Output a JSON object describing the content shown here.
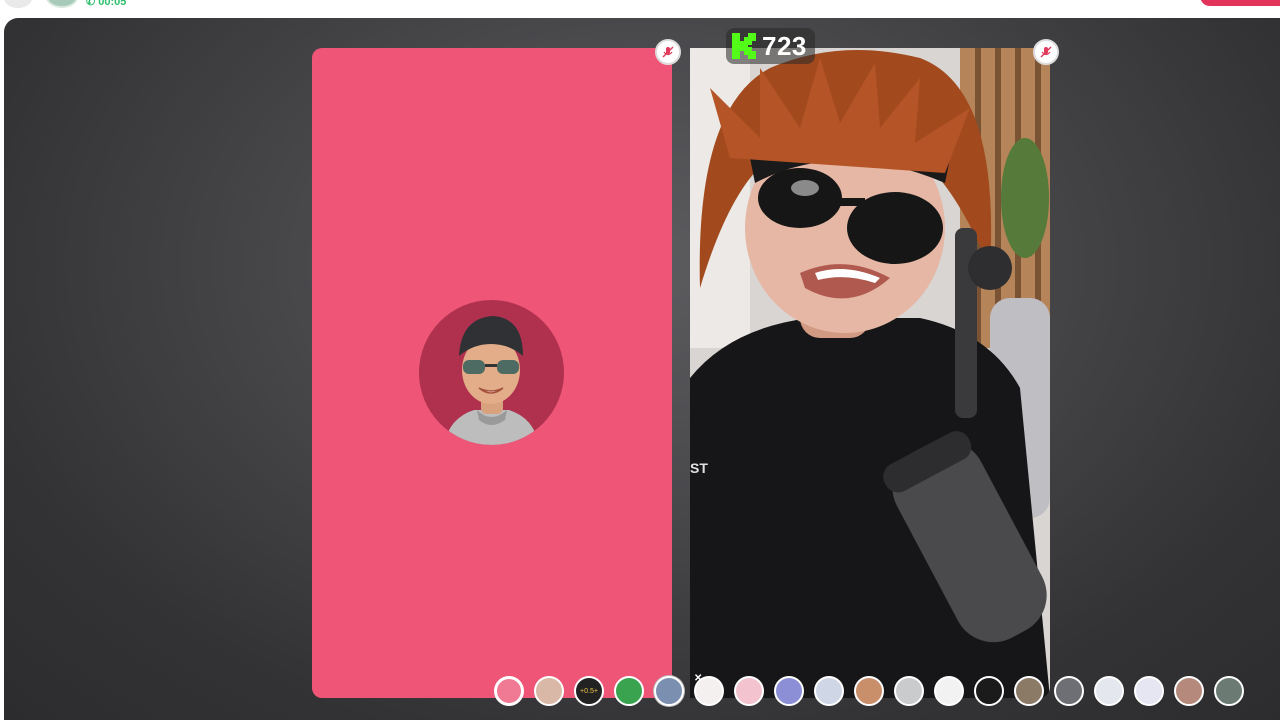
{
  "header": {
    "call_timer": "00:05"
  },
  "score": {
    "logo": "K",
    "value": "723",
    "logo_color": "#53fc18"
  },
  "tiles": {
    "left": {
      "background": "#ee5577",
      "mic_icon": "mic-muted-icon"
    },
    "right": {
      "mic_icon": "mic-muted-icon"
    }
  },
  "filters": {
    "items": [
      {
        "name": "none-filter",
        "color": "#f07a93"
      },
      {
        "name": "beard-filter",
        "color": "#d9b8a7"
      },
      {
        "name": "speed-filter",
        "label": "+0.5+",
        "color": "#222222"
      },
      {
        "name": "alien-filter",
        "color": "#3aa34f"
      },
      {
        "name": "monster-filter",
        "color": "#7b8fb0",
        "selected": true
      },
      {
        "name": "cute-face-filter",
        "color": "#f4f0f0"
      },
      {
        "name": "blush-filter",
        "color": "#f3c3cf"
      },
      {
        "name": "sparkle-filter",
        "color": "#8d8fd6"
      },
      {
        "name": "pale-face-filter",
        "color": "#cfd6e6"
      },
      {
        "name": "man-face-filter",
        "color": "#c98f6b"
      },
      {
        "name": "sad-face-filter",
        "color": "#c9cbcd"
      },
      {
        "name": "panda-filter",
        "color": "#f2f2f2"
      },
      {
        "name": "demon-filter",
        "color": "#1b1b1b"
      },
      {
        "name": "donkey-filter",
        "color": "#8a7a66"
      },
      {
        "name": "sunglasses-filter",
        "color": "#6d6f74"
      },
      {
        "name": "robot-filter",
        "color": "#e4e7ee"
      },
      {
        "name": "stars-filter",
        "color": "#e6e6f2"
      },
      {
        "name": "skin-filter",
        "color": "#b58a7c"
      },
      {
        "name": "zombie-filter",
        "color": "#6c7a74"
      }
    ]
  }
}
